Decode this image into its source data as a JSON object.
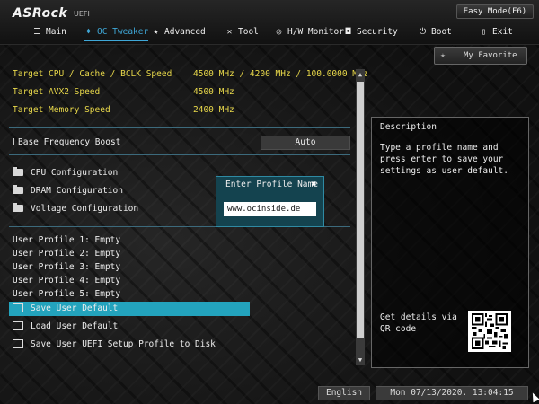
{
  "header": {
    "logo": "ASRock",
    "logo_suffix": "UEFI",
    "easy_mode": "Easy Mode(F6)",
    "tabs": [
      {
        "label": "Main",
        "icon": "list-icon",
        "active": false
      },
      {
        "label": "OC Tweaker",
        "icon": "flame-icon",
        "active": true
      },
      {
        "label": "Advanced",
        "icon": "star-icon",
        "active": false
      },
      {
        "label": "Tool",
        "icon": "tools-icon",
        "active": false
      },
      {
        "label": "H/W Monitor",
        "icon": "monitor-icon",
        "active": false
      },
      {
        "label": "Security",
        "icon": "shield-icon",
        "active": false
      },
      {
        "label": "Boot",
        "icon": "power-icon",
        "active": false
      },
      {
        "label": "Exit",
        "icon": "exit-icon",
        "active": false
      }
    ]
  },
  "favorite": {
    "label": "My Favorite",
    "icon": "star-icon"
  },
  "summary": [
    {
      "label": "Target CPU / Cache / BCLK Speed",
      "value": "4500 MHz / 4200 MHz / 100.0000 MHz"
    },
    {
      "label": "Target AVX2 Speed",
      "value": "4500 MHz"
    },
    {
      "label": "Target Memory Speed",
      "value": "2400 MHz"
    }
  ],
  "base_frequency": {
    "label": "Base Frequency Boost",
    "value": "Auto"
  },
  "submenus": [
    "CPU Configuration",
    "DRAM Configuration",
    "Voltage Configuration"
  ],
  "profiles": [
    "User Profile 1: Empty",
    "User Profile 2: Empty",
    "User Profile 3: Empty",
    "User Profile 4: Empty",
    "User Profile 5: Empty"
  ],
  "actions": [
    {
      "label": "Save User Default",
      "selected": true
    },
    {
      "label": "Load User Default",
      "selected": false
    },
    {
      "label": "Save User UEFI Setup Profile to Disk",
      "selected": false
    }
  ],
  "description": {
    "title": "Description",
    "text": "Type a profile name and press enter to save your settings as user default.",
    "qr_label": "Get details via QR code"
  },
  "popup": {
    "title": "Enter Profile Name",
    "value": "www.ocinside.de"
  },
  "footer": {
    "language": "English",
    "datetime": "Mon 07/13/2020. 13:04:15"
  },
  "colors": {
    "accent": "#3fa8d8",
    "highlight": "#23a3bd",
    "summary_text": "#e8d84a",
    "popup_bg": "#14434f"
  }
}
